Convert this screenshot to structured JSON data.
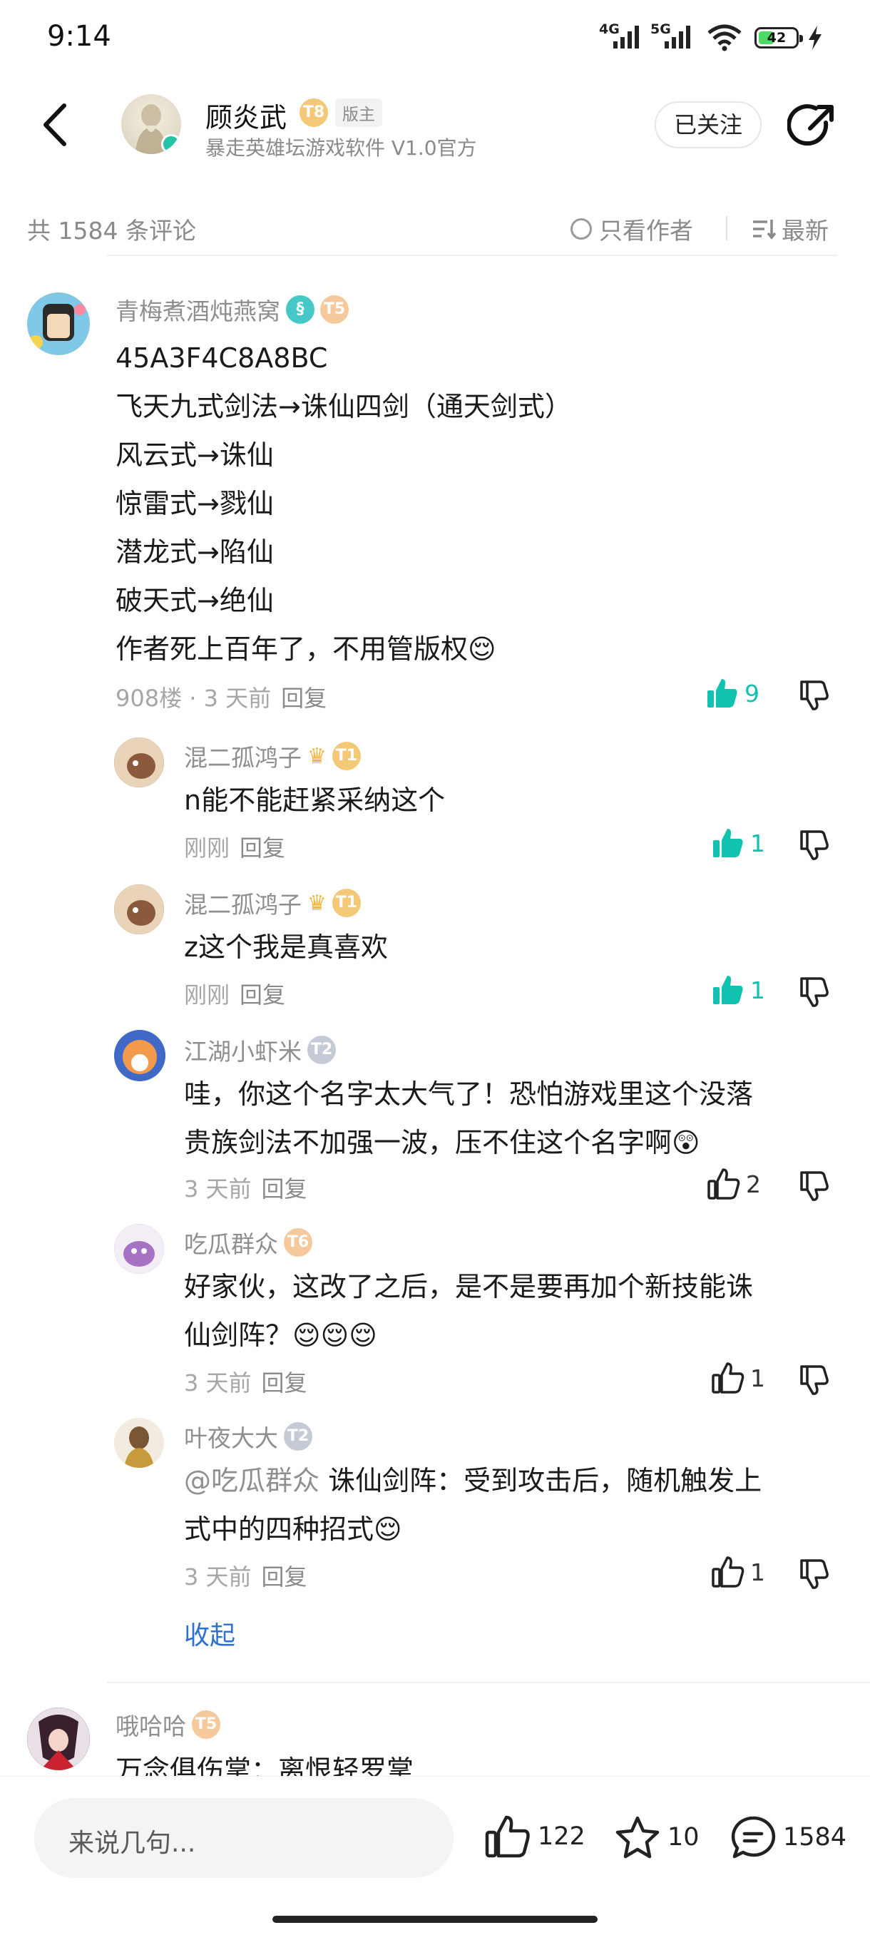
{
  "status_bar": {
    "time": "9:14",
    "net1": "4G",
    "net2": "5G",
    "battery": "42",
    "battery_level_pct": 42
  },
  "header": {
    "author": "顾炎武",
    "level": "T8",
    "role_tag": "版主",
    "subtitle": "暴走英雄坛游戏软件 V1.0官方",
    "follow_label": "已关注"
  },
  "sortbar": {
    "count": "共 1584 条评论",
    "only_author": "只看作者",
    "sort_label": "最新"
  },
  "comments": [
    {
      "user": "青梅煮酒炖燕窝",
      "level": "T5",
      "lines": [
        "45A3F4C8A8BC",
        "飞天九式剑法→诛仙四剑（通天剑式）",
        "风云式→诛仙",
        "惊雷式→戮仙",
        "潜龙式→陷仙",
        "破天式→绝仙",
        "作者死上百年了，不用管版权😌"
      ],
      "floor": "908楼 · 3 天前",
      "reply": "回复",
      "likes": "9"
    },
    {
      "user": "混二孤鸿子",
      "level": "T1",
      "crown": "♛",
      "lines": [
        "n能不能赶紧采纳这个"
      ],
      "time": "刚刚",
      "reply": "回复",
      "likes": "1"
    },
    {
      "user": "混二孤鸿子",
      "level": "T1",
      "crown": "♛",
      "lines": [
        "z这个我是真喜欢"
      ],
      "time": "刚刚",
      "reply": "回复",
      "likes": "1"
    },
    {
      "user": "江湖小虾米",
      "level": "T2",
      "lines": [
        "哇，你这个名字太大气了！恐怕游戏里这个没落",
        "贵族剑法不加强一波，压不住这个名字啊😲"
      ],
      "time": "3 天前",
      "reply": "回复",
      "likes": "2"
    },
    {
      "user": "吃瓜群众",
      "level": "T6",
      "lines": [
        "好家伙，这改了之后，是不是要再加个新技能诛",
        "仙剑阵？😌😌😌"
      ],
      "time": "3 天前",
      "reply": "回复",
      "likes": "1"
    },
    {
      "user": "叶夜大大",
      "level": "T2",
      "mention": "@吃瓜群众",
      "lines": [
        " 诛仙剑阵：受到攻击后，随机触发上",
        "式中的四种招式😌"
      ],
      "time": "3 天前",
      "reply": "回复",
      "likes": "1"
    }
  ],
  "collapse_label": "收起",
  "next_comment": {
    "user": "哦哈哈",
    "level": "T5",
    "preview": "万念俱伤掌：离恨轻罗掌"
  },
  "bottom_bar": {
    "placeholder": "来说几句...",
    "likes": "122",
    "favorites": "10",
    "comments": "1584"
  },
  "colors": {
    "accent_teal": "#12c2b1",
    "link_blue": "#2f6fd1",
    "gray_text": "#8f8f8f"
  }
}
